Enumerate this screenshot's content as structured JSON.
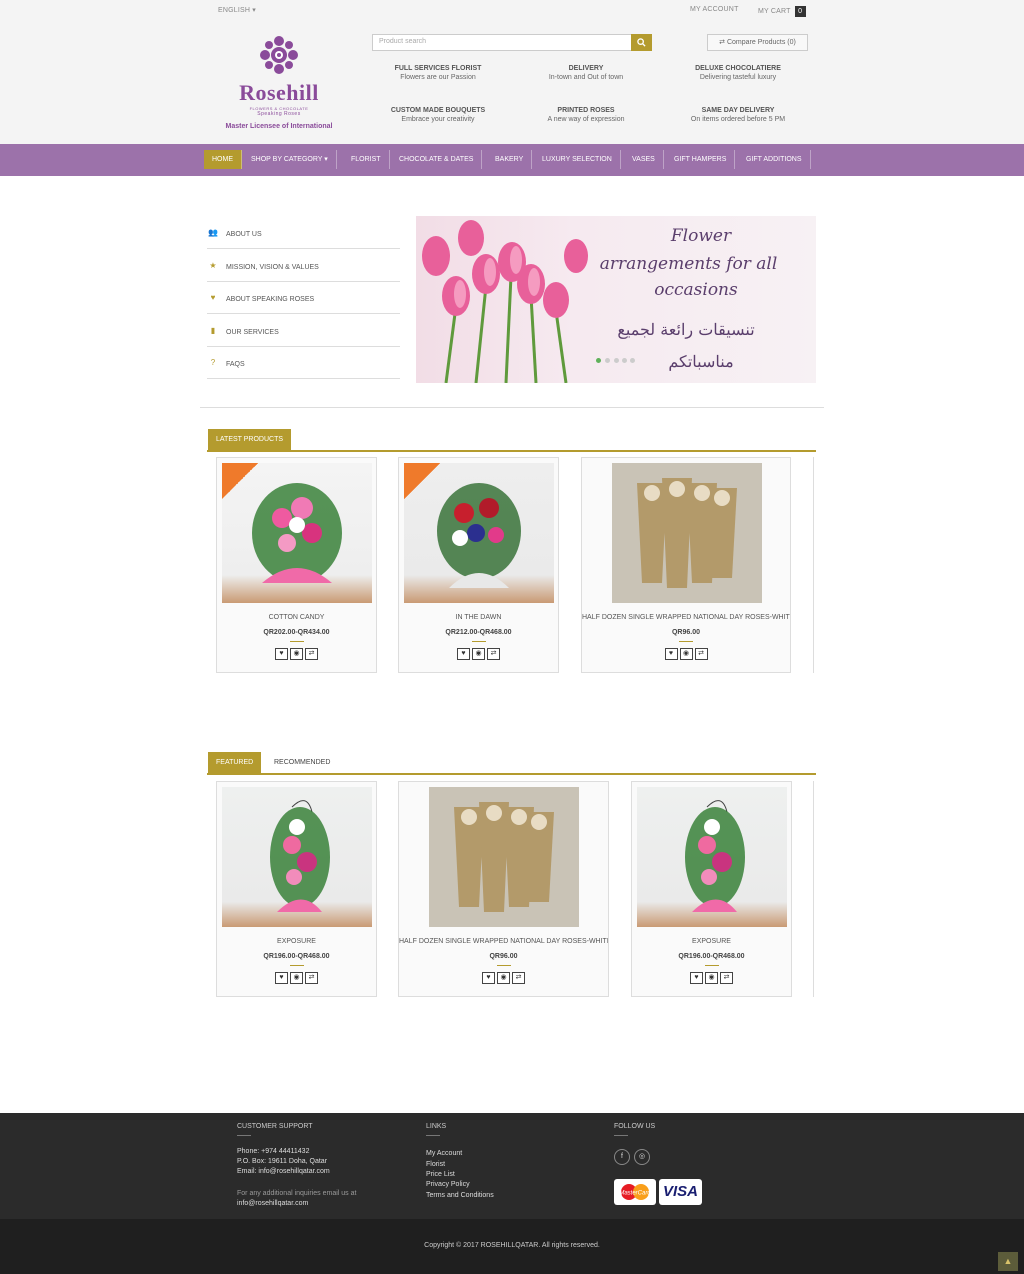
{
  "topbar": {
    "language": "ENGLISH ▾",
    "my_account": "MY ACCOUNT",
    "my_cart": "MY CART",
    "cart_count": "0"
  },
  "logo": {
    "name": "Rosehill",
    "subtitle": "FLOWERS & CHOCOLATE",
    "brand": "Speaking Roses",
    "license": "Master Licensee of International"
  },
  "search": {
    "placeholder": "Product search",
    "compare": "Compare Products (0)"
  },
  "features": [
    {
      "title": "FULL SERVICES FLORIST",
      "sub": "Flowers are our Passion"
    },
    {
      "title": "DELIVERY",
      "sub": "In-town and Out of town"
    },
    {
      "title": "DELUXE CHOCOLATIERE",
      "sub": "Delivering tasteful luxury"
    },
    {
      "title": "CUSTOM MADE BOUQUETS",
      "sub": "Embrace your creativity"
    },
    {
      "title": "PRINTED ROSES",
      "sub": "A new way of expression"
    },
    {
      "title": "SAME DAY DELIVERY",
      "sub": "On items ordered before 5 PM"
    }
  ],
  "nav": [
    "HOME",
    "SHOP BY CATEGORY ▾",
    "FLORIST",
    "CHOCOLATE & DATES",
    "BAKERY",
    "LUXURY SELECTION",
    "VASES",
    "GIFT HAMPERS",
    "GIFT ADDITIONS"
  ],
  "sidebar": [
    {
      "label": "ABOUT US",
      "icon": "users-icon"
    },
    {
      "label": "MISSION, VISION & VALUES",
      "icon": "star-icon"
    },
    {
      "label": "ABOUT SPEAKING ROSES",
      "icon": "heart-icon"
    },
    {
      "label": "OUR SERVICES",
      "icon": "book-icon"
    },
    {
      "label": "FAQS",
      "icon": "question-icon"
    }
  ],
  "slider": {
    "line1": "Flower",
    "line2": "arrangements for all",
    "line3": "occasions",
    "arabic1": "تنسيقات رائعة لجميع",
    "arabic2": "مناسباتكم"
  },
  "latest": {
    "tab": "LATEST PRODUCTS",
    "products": [
      {
        "name": "COTTON CANDY",
        "price": "QR202.00-QR434.00"
      },
      {
        "name": "IN THE DAWN",
        "price": "QR212.00-QR468.00"
      },
      {
        "name": "HALF DOZEN SINGLE WRAPPED NATIONAL DAY ROSES-WHITE",
        "price": "QR96.00"
      }
    ]
  },
  "featured": {
    "tab_featured": "FEATURED",
    "tab_recommended": "RECOMMENDED",
    "products": [
      {
        "name": "EXPOSURE",
        "price": "QR196.00-QR468.00"
      },
      {
        "name": "HALF DOZEN SINGLE WRAPPED NATIONAL DAY ROSES-WHITE",
        "price": "QR96.00"
      },
      {
        "name": "EXPOSURE",
        "price": "QR196.00-QR468.00"
      }
    ]
  },
  "footer": {
    "support_title": "CUSTOMER SUPPORT",
    "phone": "Phone:  +974 44411432",
    "pobox": "P.O. Box: 19611 Doha, Qatar",
    "email": "Email: info@rosehillqatar.com",
    "inquiry": "For any additional inquiries email us at",
    "inquiry_email": "info@rosehillqatar.com",
    "links_title": "LINKS",
    "links": [
      "My Account",
      "Florist",
      "Price List",
      "Privacy Policy",
      "Terms and Conditions"
    ],
    "follow_title": "FOLLOW US",
    "copyright": "Copyright © 2017 ROSEHILLQATAR. All rights reserved.",
    "payment": [
      "MasterCard",
      "VISA"
    ]
  },
  "colors": {
    "accent": "#b49b2e",
    "nav": "#9c72aa",
    "brand": "#8a4b9a"
  }
}
